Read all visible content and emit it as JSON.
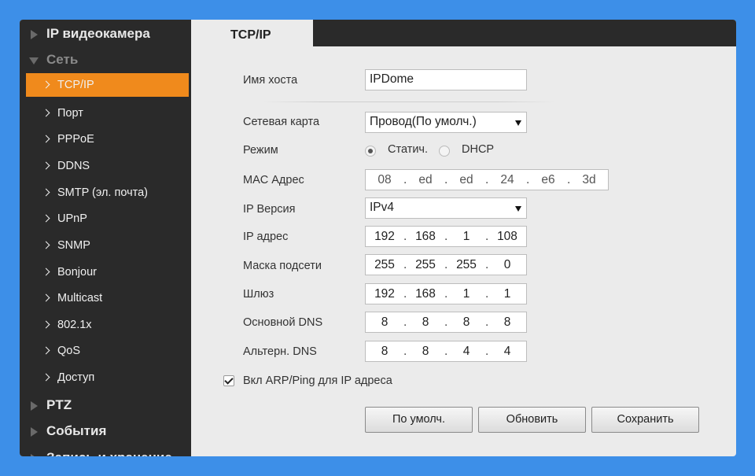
{
  "sidebar": {
    "categories": {
      "camera": "IP видеокамера",
      "network": "Сеть",
      "ptz": "PTZ",
      "events": "События",
      "storage": "Запись и хранение"
    },
    "items": [
      "TCP/IP",
      "Порт",
      "PPPoE",
      "DDNS",
      "SMTP (эл. почта)",
      "UPnP",
      "SNMP",
      "Bonjour",
      "Multicast",
      "802.1x",
      "QoS",
      "Доступ"
    ],
    "active_index": 0
  },
  "tab": {
    "label": "TCP/IP"
  },
  "form": {
    "hostname": {
      "label": "Имя хоста",
      "value": "IPDome"
    },
    "nic": {
      "label": "Сетевая карта",
      "value": "Провод(По умолч.)"
    },
    "mode": {
      "label": "Режим",
      "static_label": "Статич.",
      "dhcp_label": "DHCP",
      "selected": "Статич."
    },
    "mac": {
      "label": "MAC Адрес",
      "octets": [
        "08",
        "ed",
        "ed",
        "24",
        "e6",
        "3d"
      ]
    },
    "ip_version": {
      "label": "IP Версия",
      "value": "IPv4"
    },
    "ip": {
      "label": "IP адрес",
      "octets": [
        "192",
        "168",
        "1",
        "108"
      ]
    },
    "mask": {
      "label": "Маска подсети",
      "octets": [
        "255",
        "255",
        "255",
        "0"
      ]
    },
    "gateway": {
      "label": "Шлюз",
      "octets": [
        "192",
        "168",
        "1",
        "1"
      ]
    },
    "dns1": {
      "label": "Основной DNS",
      "octets": [
        "8",
        "8",
        "8",
        "8"
      ]
    },
    "dns2": {
      "label": "Альтерн. DNS",
      "octets": [
        "8",
        "8",
        "4",
        "4"
      ]
    },
    "arp_ping": {
      "label": "Вкл ARP/Ping для IP адреса",
      "checked": true
    }
  },
  "buttons": {
    "default": "По умолч.",
    "refresh": "Обновить",
    "save": "Сохранить"
  },
  "colors": {
    "accent": "#f08a1c",
    "sidebar_bg": "#2a2a2a",
    "page_bg": "#3d8fe8",
    "content_bg": "#ebebeb"
  }
}
